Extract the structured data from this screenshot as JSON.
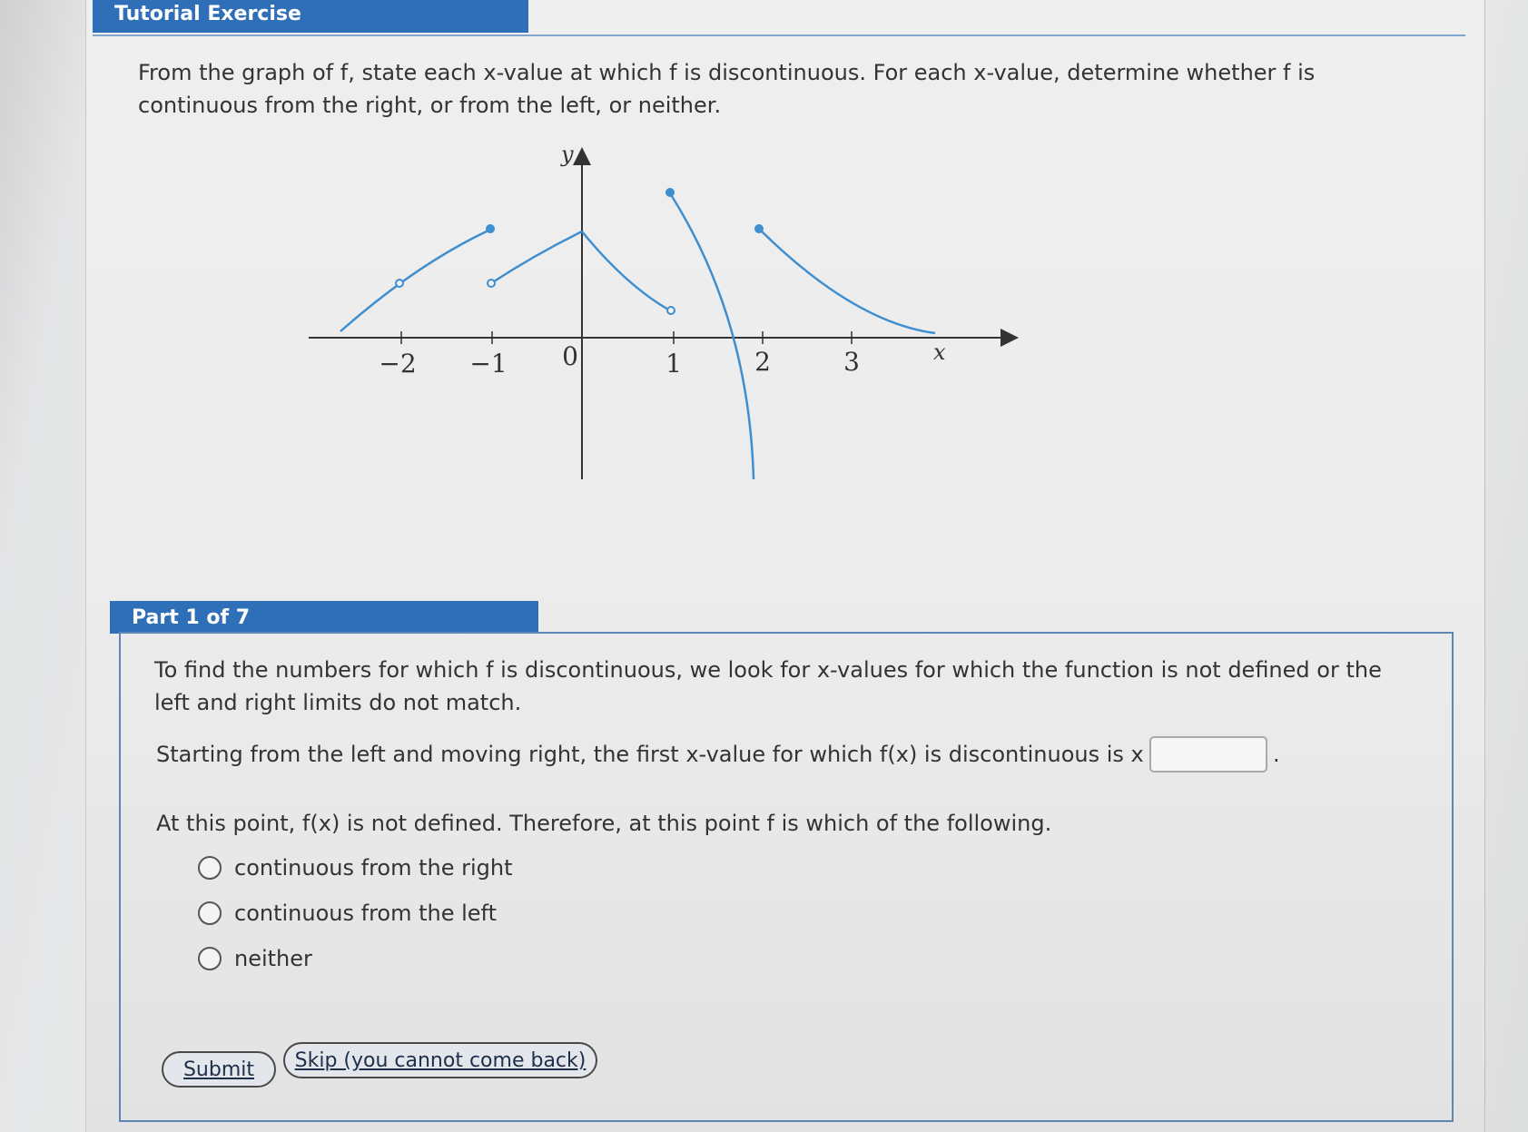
{
  "header": {
    "title": "Tutorial Exercise"
  },
  "prompt": {
    "text": "From the graph of f, state each x-value at which f is discontinuous. For each x-value, determine whether f is continuous from the right, or from the left, or neither."
  },
  "graph": {
    "axis_labels": {
      "y": "y",
      "x": "x"
    },
    "x_ticks": [
      "−2",
      "−1",
      "0",
      "1",
      "2",
      "3"
    ],
    "curve_color": "#3f8fd0"
  },
  "part": {
    "label": "Part 1 of 7",
    "intro": "To find the numbers for which f is discontinuous, we look for x-values for which the function is not defined or the left and right limits do not match.",
    "question_prefix": "Starting from the left and moving right, the first x-value for which f(x) is discontinuous is x =",
    "question_suffix": ".",
    "answer_value": "",
    "followup": "At this point, f(x) is not defined. Therefore, at this point f is which of the following.",
    "options": [
      "continuous from the right",
      "continuous from the left",
      "neither"
    ],
    "submit_label": "Submit",
    "skip_label": "Skip (you cannot come back)"
  }
}
